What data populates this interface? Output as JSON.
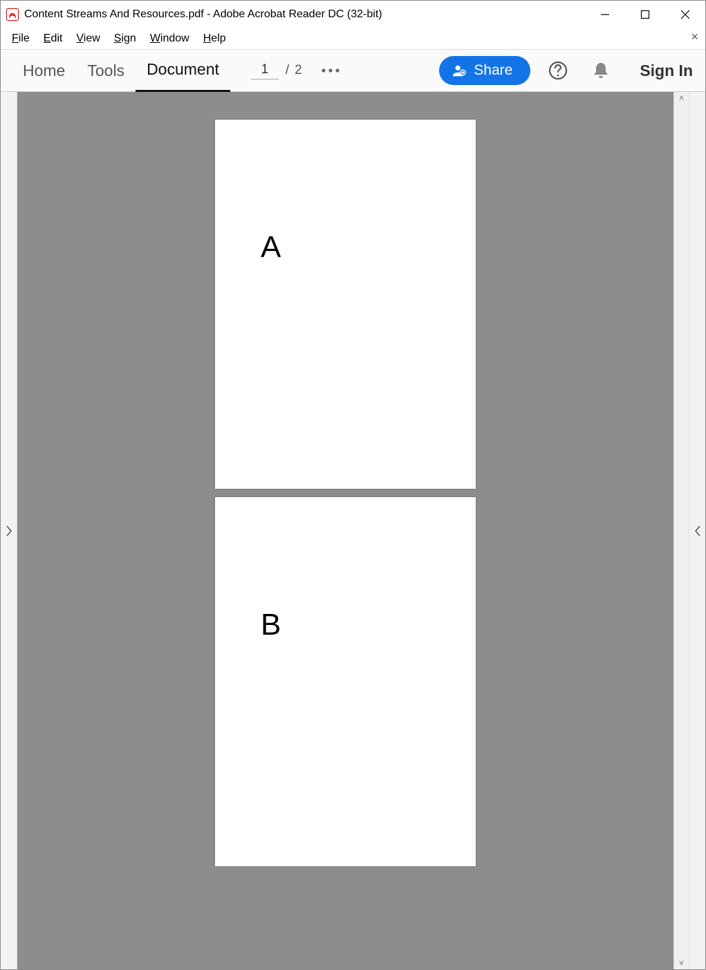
{
  "titlebar": {
    "title": "Content Streams And Resources.pdf - Adobe Acrobat Reader DC (32-bit)"
  },
  "menubar": {
    "items": [
      {
        "accel": "F",
        "rest": "ile"
      },
      {
        "accel": "E",
        "rest": "dit"
      },
      {
        "accel": "V",
        "rest": "iew"
      },
      {
        "accel": "S",
        "rest": "ign"
      },
      {
        "accel": "W",
        "rest": "indow"
      },
      {
        "accel": "H",
        "rest": "elp"
      }
    ],
    "close_glyph": "×"
  },
  "toolbar": {
    "tabs": {
      "home": "Home",
      "tools": "Tools",
      "document": "Document"
    },
    "page_current": "1",
    "page_sep": "/",
    "page_total": "2",
    "share_label": "Share",
    "signin_label": "Sign In"
  },
  "document": {
    "pages": [
      {
        "content": "A"
      },
      {
        "content": "B"
      }
    ]
  }
}
